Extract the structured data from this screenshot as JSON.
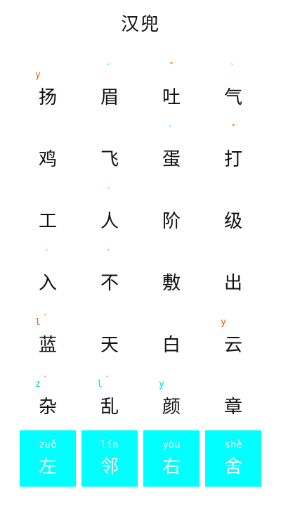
{
  "title": "汉兜",
  "grid": [
    {
      "char": "扬",
      "pinyin": "y",
      "pinyin_color": "#e65c00"
    },
    {
      "char": "眉",
      "tone": "ˊ",
      "tone_color": "#00d8e0"
    },
    {
      "char": "吐",
      "tone": "ˇ",
      "tone_color": "#e65c00"
    },
    {
      "char": "气",
      "tone": "ˋ",
      "tone_color": "#00d8e0"
    },
    {
      "char": "鸡",
      "tone": ""
    },
    {
      "char": "飞",
      "tone": ""
    },
    {
      "char": "蛋",
      "tone": "ˋ",
      "tone_color": "#00d8e0"
    },
    {
      "char": "打",
      "tone": "ˇ",
      "tone_color": "#e65c00"
    },
    {
      "char": "工",
      "tone": ""
    },
    {
      "char": "人",
      "tone": "ˊ",
      "tone_color": "#00d8e0"
    },
    {
      "char": "阶",
      "tone": ""
    },
    {
      "char": "级",
      "tone": ""
    },
    {
      "char": "入",
      "tone": "ˋ",
      "tone_color": "#e65c00"
    },
    {
      "char": "不",
      "tone": "ˋ",
      "tone_color": "#e65c00"
    },
    {
      "char": "敷",
      "tone": ""
    },
    {
      "char": "出",
      "tone": ""
    },
    {
      "char": "蓝",
      "pinyin": "l",
      "pinyin_color": "#e65c00",
      "tone": "ˊ",
      "tone_color": "#e65c00"
    },
    {
      "char": "天",
      "tone": ""
    },
    {
      "char": "白",
      "tone": ""
    },
    {
      "char": "云",
      "pinyin": "y",
      "pinyin_color": "#e65c00"
    },
    {
      "char": "杂",
      "pinyin": "z",
      "pinyin_color": "#00d8e0",
      "tone": "ˊ",
      "tone_color": "#e65c00"
    },
    {
      "char": "乱",
      "pinyin": "l",
      "pinyin_color": "#00d8e0",
      "tone": "ˋ",
      "tone_color": "#e65c00"
    },
    {
      "char": "颜",
      "pinyin": "y",
      "pinyin_color": "#00d8e0"
    },
    {
      "char": "章",
      "tone": ""
    }
  ],
  "answer_tiles": [
    {
      "pinyin": "zuǒ",
      "char": "左"
    },
    {
      "pinyin": "lín",
      "char": "邻"
    },
    {
      "pinyin": "yòu",
      "char": "右"
    },
    {
      "pinyin": "shè",
      "char": "舍"
    }
  ],
  "colors": {
    "correct_tile": "#00ffff",
    "cyan_hint": "#00d8e0",
    "orange_hint": "#e65c00"
  }
}
